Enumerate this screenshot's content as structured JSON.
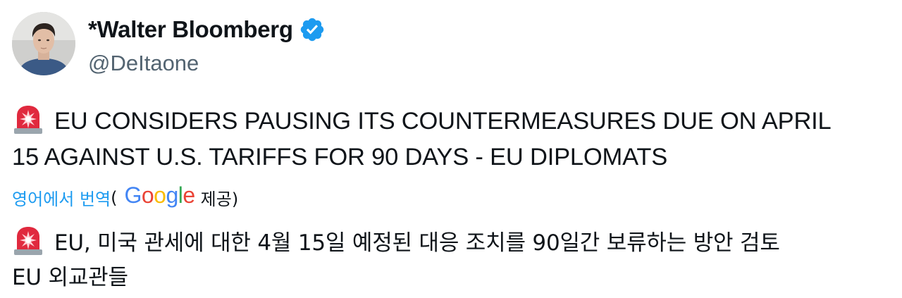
{
  "user": {
    "display_name": "*Walter Bloomberg",
    "handle": "@DeItaone",
    "verified_icon": "verified-badge-icon",
    "avatar_icon": "avatar"
  },
  "tweet": {
    "emoji": "police-car-light-icon",
    "line1": "EU CONSIDERS PAUSING ITS COUNTERMEASURES DUE ON APRIL",
    "line2": "15 AGAINST U.S. TARIFFS FOR 90 DAYS - EU DIPLOMATS"
  },
  "translation": {
    "link": "영어에서 번역",
    "open_paren": "(",
    "provider_letters": [
      "G",
      "o",
      "o",
      "g",
      "l",
      "e"
    ],
    "provider_colors": [
      "#4285F4",
      "#EA4335",
      "#FBBC05",
      "#4285F4",
      "#34A853",
      "#EA4335"
    ],
    "provided_by": "제공)",
    "line1": "EU, 미국 관세에 대한 4월 15일 예정된 대응 조치를 90일간 보류하는 방안 검토",
    "line2": "EU 외교관들"
  },
  "colors": {
    "link": "#1d9bf0",
    "secondary_text": "#536471",
    "verified": "#1d9bf0",
    "siren": "#e0293e"
  }
}
